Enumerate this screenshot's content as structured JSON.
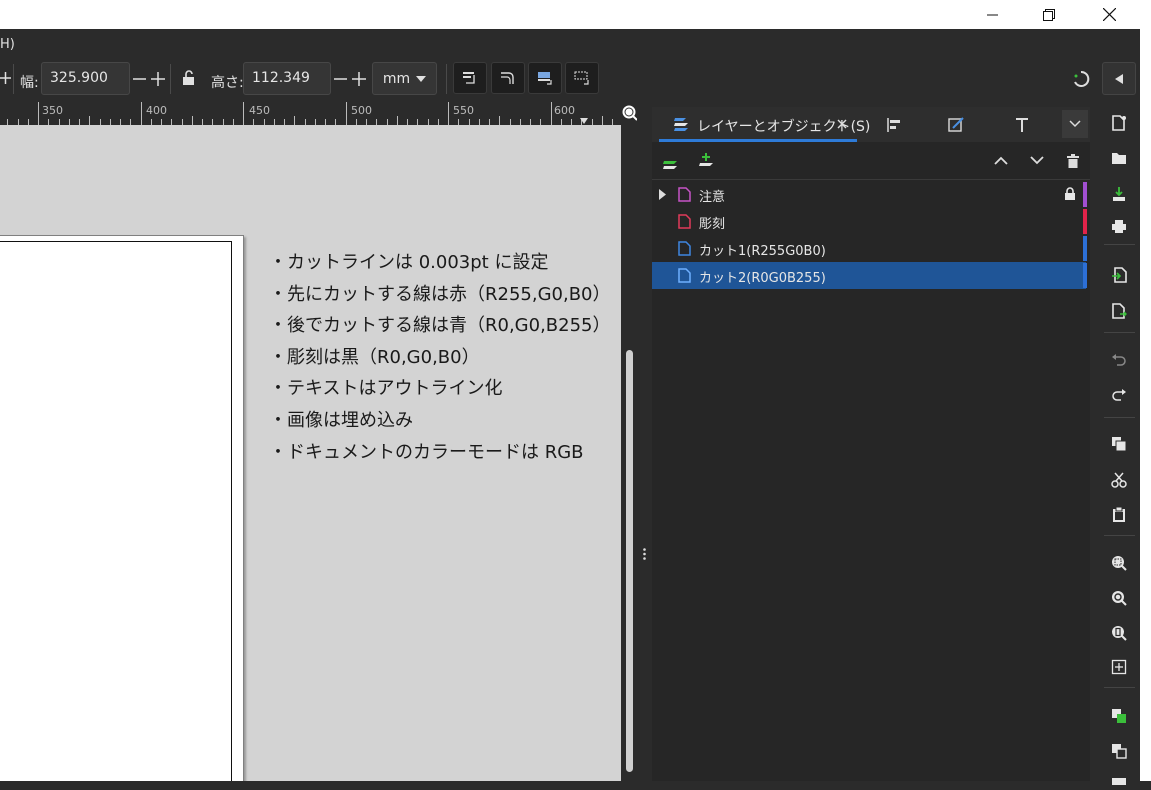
{
  "menubar": {
    "fragment": "H)"
  },
  "toolbar": {
    "width_label": "幅:",
    "width_value": "325.900",
    "height_label": "高さ:",
    "height_value": "112.349",
    "unit": "mm"
  },
  "ruler": {
    "labels": [
      "350",
      "400",
      "450",
      "500",
      "550",
      "600"
    ]
  },
  "notes": {
    "lines": [
      "・カットラインは 0.003pt に設定",
      "・先にカットする線は赤（R255,G0,B0）",
      "・後でカットする線は青（R0,G0,B255）",
      "・彫刻は黒（R0,G0,B0）",
      "・テキストはアウトライン化",
      "・画像は埋め込み",
      "・ドキュメントのカラーモードは RGB"
    ]
  },
  "panel": {
    "active_tab": "レイヤーとオブジェクト(S)",
    "layers": [
      {
        "name": "注意",
        "icon_color": "#c653c6",
        "bar_color": "#a14fd1",
        "locked": true,
        "expandable": true,
        "selected": false
      },
      {
        "name": "彫刻",
        "icon_color": "#e03a5a",
        "bar_color": "#e0234a",
        "locked": false,
        "expandable": false,
        "selected": false
      },
      {
        "name": "カット1(R255G0B0)",
        "icon_color": "#3f86e0",
        "bar_color": "#2c6fd6",
        "locked": false,
        "expandable": false,
        "selected": false
      },
      {
        "name": "カット2(R0G0B255)",
        "icon_color": "#3f86e0",
        "bar_color": "#2c6fd6",
        "locked": false,
        "expandable": false,
        "selected": true
      }
    ]
  },
  "colors": {
    "accent": "#2e7bd8",
    "selection": "#1f5597",
    "canvas": "#d3d3d3"
  }
}
